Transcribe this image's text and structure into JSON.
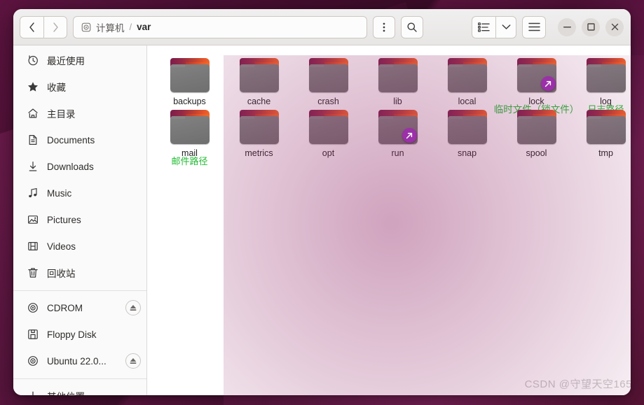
{
  "window": {
    "title": "var",
    "controls": {
      "minimize": "−",
      "maximize": "□",
      "close": "×"
    }
  },
  "toolbar": {
    "back_label": "‹",
    "forward_label": "›",
    "menu_dots_label": "⋮",
    "search_label": "search-icon",
    "view_list_label": "list-view-icon",
    "view_dropdown_label": "chevron-down-icon",
    "hamburger_label": "hamburger-icon"
  },
  "breadcrumb": {
    "computer_icon": "computer-icon",
    "root": "计算机",
    "separator": "/",
    "current": "var"
  },
  "sidebar": {
    "groups": [
      {
        "items": [
          {
            "label": "最近使用",
            "icon": "clock-icon",
            "eject": false
          },
          {
            "label": "收藏",
            "icon": "star-icon",
            "eject": false
          },
          {
            "label": "主目录",
            "icon": "home-icon",
            "eject": false
          },
          {
            "label": "Documents",
            "icon": "document-icon",
            "eject": false
          },
          {
            "label": "Downloads",
            "icon": "download-icon",
            "eject": false
          },
          {
            "label": "Music",
            "icon": "music-icon",
            "eject": false
          },
          {
            "label": "Pictures",
            "icon": "picture-icon",
            "eject": false
          },
          {
            "label": "Videos",
            "icon": "video-icon",
            "eject": false
          },
          {
            "label": "回收站",
            "icon": "trash-icon",
            "eject": false
          }
        ]
      },
      {
        "items": [
          {
            "label": "CDROM",
            "icon": "disc-icon",
            "eject": true
          },
          {
            "label": "Floppy Disk",
            "icon": "floppy-icon",
            "eject": false
          },
          {
            "label": "Ubuntu 22.0...",
            "icon": "disc-icon",
            "eject": true
          }
        ]
      },
      {
        "items": [
          {
            "label": "其他位置",
            "icon": "plus-icon",
            "eject": false
          }
        ]
      }
    ]
  },
  "files": [
    {
      "name": "backups",
      "symlink": false,
      "annotation": ""
    },
    {
      "name": "cache",
      "symlink": false,
      "annotation": ""
    },
    {
      "name": "crash",
      "symlink": false,
      "annotation": ""
    },
    {
      "name": "lib",
      "symlink": false,
      "annotation": ""
    },
    {
      "name": "local",
      "symlink": false,
      "annotation": ""
    },
    {
      "name": "lock",
      "symlink": true,
      "annotation": "临时文件（锁文件）"
    },
    {
      "name": "log",
      "symlink": false,
      "annotation": "日志路径"
    },
    {
      "name": "mail",
      "symlink": false,
      "annotation": "邮件路径"
    },
    {
      "name": "metrics",
      "symlink": false,
      "annotation": ""
    },
    {
      "name": "opt",
      "symlink": false,
      "annotation": ""
    },
    {
      "name": "run",
      "symlink": true,
      "annotation": ""
    },
    {
      "name": "snap",
      "symlink": false,
      "annotation": ""
    },
    {
      "name": "spool",
      "symlink": false,
      "annotation": ""
    },
    {
      "name": "tmp",
      "symlink": false,
      "annotation": ""
    }
  ],
  "watermark": "CSDN @守望天空165",
  "colors": {
    "annotation_green": "#22bb33",
    "symlink_purple": "#9b30a8",
    "folder_gray": "#787878",
    "folder_orange": "#e8582a",
    "folder_maroon": "#7b1c4b",
    "desktop_purple": "#4a0f33"
  }
}
